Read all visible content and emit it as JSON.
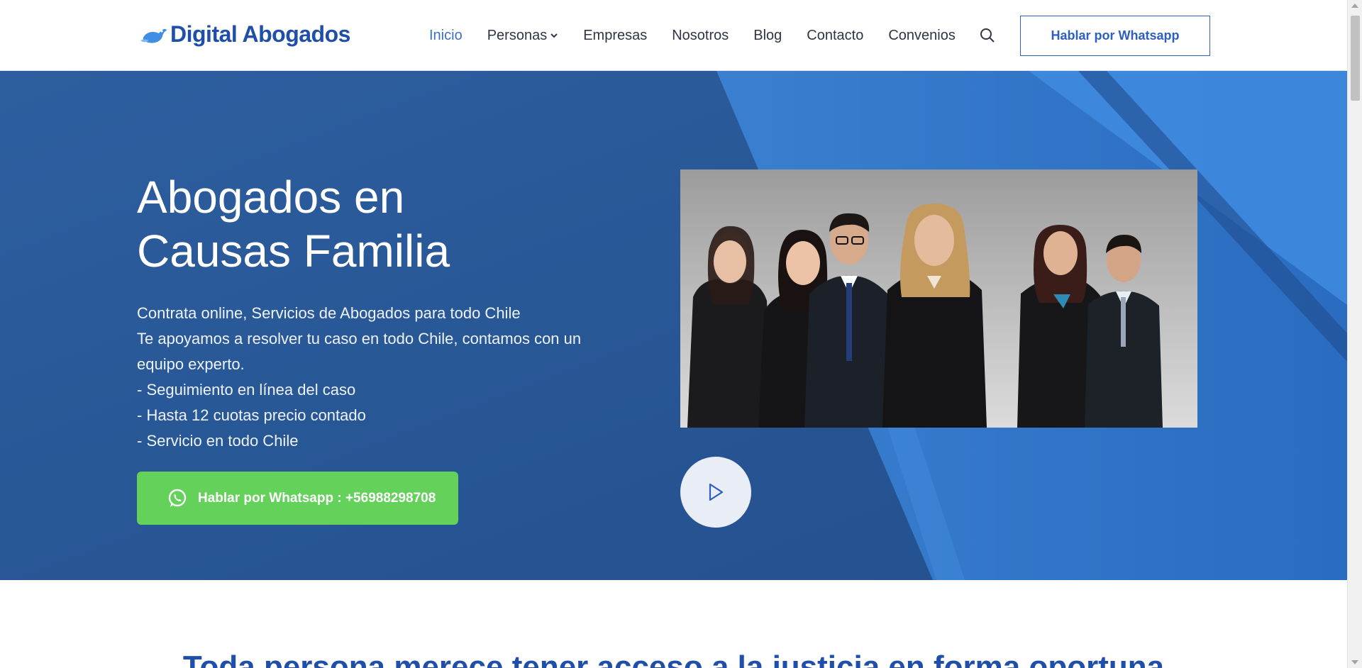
{
  "header": {
    "logo_text": "Digital Abogados",
    "nav": [
      {
        "label": "Inicio",
        "active": true
      },
      {
        "label": "Personas",
        "has_dropdown": true
      },
      {
        "label": "Empresas"
      },
      {
        "label": "Nosotros"
      },
      {
        "label": "Blog"
      },
      {
        "label": "Contacto"
      },
      {
        "label": "Convenios"
      }
    ],
    "search_icon": "search-icon",
    "cta_label": "Hablar por Whatsapp"
  },
  "hero": {
    "title_line1": "Abogados en",
    "title_line2": "Causas Familia",
    "desc_lines": [
      "Contrata online, Servicios de Abogados para todo Chile",
      "Te apoyamos a resolver tu caso en todo Chile, contamos con un",
      "equipo experto.",
      "- Seguimiento en línea del caso",
      "- Hasta 12 cuotas precio contado",
      "- Servicio en todo Chile"
    ],
    "whatsapp_button": "Hablar por Whatsapp : +56988298708",
    "play_icon": "play-icon"
  },
  "section": {
    "title": "Toda persona merece tener acceso a la justicia en forma oportuna"
  },
  "colors": {
    "brand_blue": "#1f4fa8",
    "nav_active": "#3a6fc9",
    "whatsapp_green": "#63d15a",
    "hero_blue": "#2a5fa6"
  }
}
